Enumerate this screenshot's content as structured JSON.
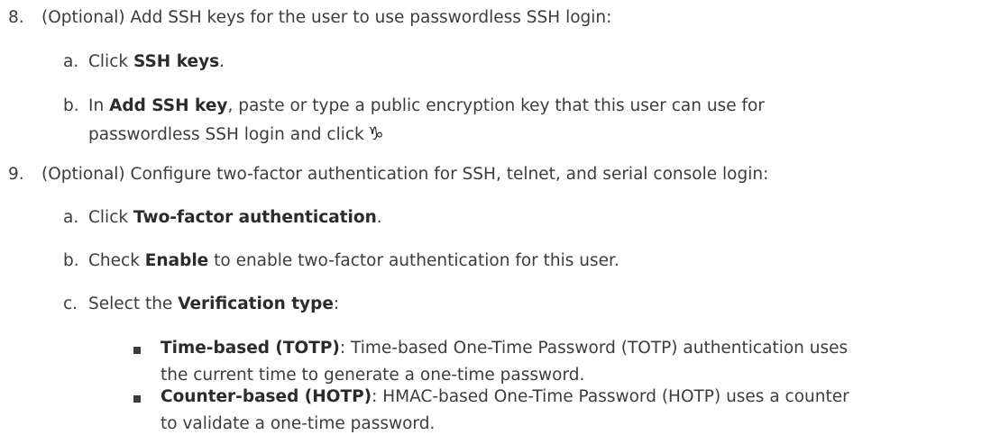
{
  "steps": [
    {
      "number": "8.",
      "text": "(Optional) Add SSH keys for the user to use passwordless SSH login:",
      "substeps": [
        {
          "letter": "a.",
          "pre": "Click ",
          "bold": "SSH keys",
          "post": "."
        },
        {
          "letter": "b.",
          "pre": "In ",
          "bold": "Add SSH key",
          "post": ", paste or type a public encryption key that this user can use for",
          "continuation": "passwordless SSH login and click",
          "icon": "add-key-icon",
          "icon_glyph": "♑"
        }
      ]
    },
    {
      "number": "9.",
      "text": "(Optional) Configure two-factor authentication for SSH, telnet, and serial console login:",
      "substeps": [
        {
          "letter": "a.",
          "pre": "Click ",
          "bold": "Two-factor authentication",
          "post": "."
        },
        {
          "letter": "b.",
          "pre": "Check ",
          "bold": "Enable",
          "post": " to enable two-factor authentication for this user."
        },
        {
          "letter": "c.",
          "pre": "Select the ",
          "bold": "Verification type",
          "post": ":"
        }
      ],
      "bullets": [
        {
          "bold": "Time-based (TOTP)",
          "text": ": Time-based One-Time Password (TOTP) authentication uses",
          "continuation": "the current time to generate a one-time password."
        },
        {
          "bold": "Counter-based (HOTP)",
          "text": ": HMAC-based One-Time Password (HOTP) uses a counter",
          "continuation": "to validate a one-time password."
        }
      ]
    }
  ]
}
